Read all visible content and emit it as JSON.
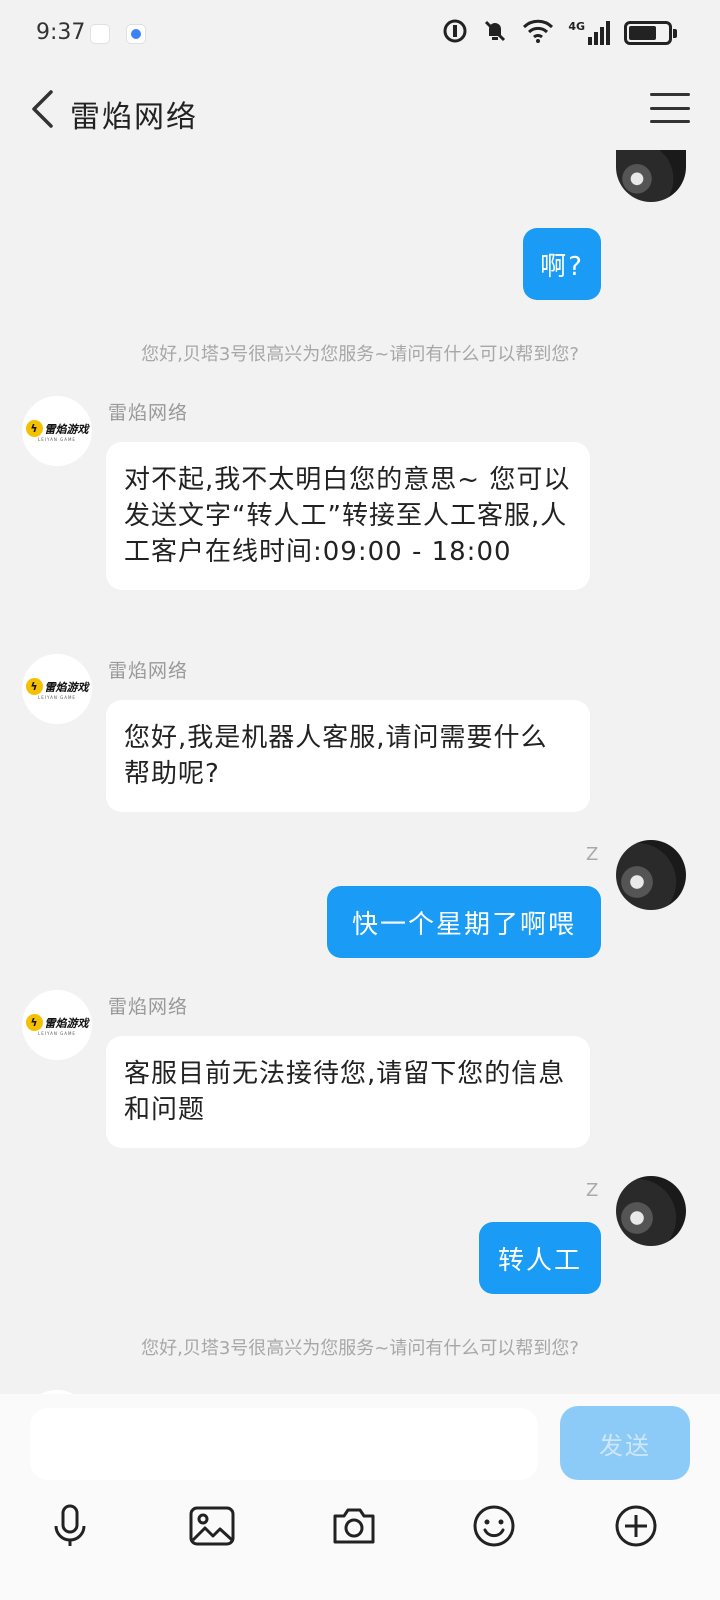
{
  "status_bar": {
    "time": "9:37",
    "network_label": "4G",
    "battery_level": 0.7
  },
  "header": {
    "title": "雷焰网络"
  },
  "messages": [
    {
      "type": "user",
      "text": "啊?"
    },
    {
      "type": "system",
      "text": "您好,贝塔3号很高兴为您服务~请问有什么可以帮到您?"
    },
    {
      "type": "bot",
      "sender": "雷焰网络",
      "text": "对不起,我不太明白您的意思~ 您可以发送文字“转人工”转接至人工客服,人工客户在线时间:09:00 - 18:00"
    },
    {
      "type": "bot",
      "sender": "雷焰网络",
      "text": "您好,我是机器人客服,请问需要什么帮助呢?"
    },
    {
      "type": "user",
      "mark": "Z",
      "text": "快一个星期了啊喂"
    },
    {
      "type": "bot",
      "sender": "雷焰网络",
      "text": "客服目前无法接待您,请留下您的信息和问题"
    },
    {
      "type": "user",
      "mark": "Z",
      "text": "转人工"
    },
    {
      "type": "system",
      "text": "您好,贝塔3号很高兴为您服务~请问有什么可以帮到您?"
    }
  ],
  "bot_logo": {
    "text": "雷焰游戏",
    "sub": "LEIYAN GAME",
    "bolt": "ϟ",
    "color": "#f4c000"
  },
  "input": {
    "value": "",
    "placeholder": "",
    "send_label": "发送"
  },
  "toolbar": {
    "icons": [
      "microphone-icon",
      "image-icon",
      "camera-icon",
      "emoji-icon",
      "plus-icon"
    ]
  },
  "colors": {
    "accent": "#1a9bf5",
    "background": "#f2f2f2",
    "send_disabled": "#8ccbf7"
  }
}
